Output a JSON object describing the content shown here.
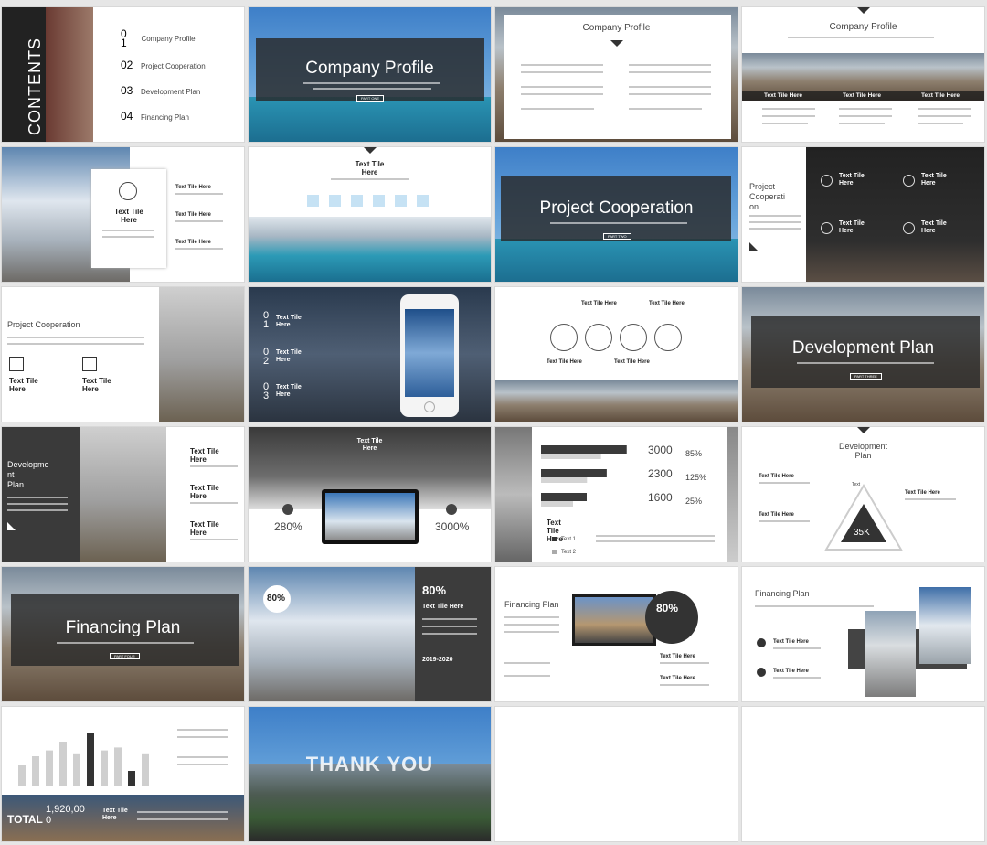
{
  "slides": {
    "s1": {
      "heading": "CONTENTS",
      "items": [
        {
          "num": "0\n1",
          "label": "Company Profile"
        },
        {
          "num": "02",
          "label": "Project Cooperation"
        },
        {
          "num": "03",
          "label": "Development Plan"
        },
        {
          "num": "04",
          "label": "Financing Plan"
        }
      ]
    },
    "s2": {
      "title": "Company Profile",
      "badge": "PART ONE"
    },
    "s3": {
      "title": "Company Profile"
    },
    "s4": {
      "title": "Company Profile",
      "labels": [
        "Text Tile Here",
        "Text Tile Here",
        "Text Tile Here"
      ]
    },
    "s5": {
      "card_title": "Text Tile\nHere",
      "items": [
        "Text Tile Here",
        "Text Tile Here",
        "Text Tile Here"
      ]
    },
    "s6": {
      "title": "Text Tile\nHere"
    },
    "s7": {
      "title": "Project Cooperation",
      "badge": "PART TWO"
    },
    "s8": {
      "title": "Project\nCooperati\non",
      "items": [
        "Text Tile\nHere",
        "Text Tile\nHere",
        "Text Tile\nHere",
        "Text Tile\nHere"
      ]
    },
    "s9": {
      "title": "Project Cooperation",
      "items": [
        "Text Tile\nHere",
        "Text Tile\nHere"
      ]
    },
    "s10": {
      "items": [
        {
          "num": "0\n1",
          "label": "Text Tile\nHere"
        },
        {
          "num": "0\n2",
          "label": "Text Tile\nHere"
        },
        {
          "num": "0\n3",
          "label": "Text Tile\nHere"
        }
      ]
    },
    "s11": {
      "labels": [
        "Text Tile Here",
        "Text Tile Here",
        "Text Tile Here",
        "Text Tile Here"
      ]
    },
    "s12": {
      "title": "Development Plan",
      "badge": "PART THREE"
    },
    "s13": {
      "title": "Developme\nnt\nPlan",
      "items": [
        "Text Tile\nHere",
        "Text Tile\nHere",
        "Text Tile\nHere"
      ]
    },
    "s14": {
      "title": "Text Tile\nHere",
      "stat_left": "280%",
      "stat_right": "3000%"
    },
    "s15": {
      "chart_data": {
        "type": "bar",
        "values": [
          3000,
          2300,
          1600
        ],
        "percents": [
          "85%",
          "125%",
          "25%"
        ],
        "series": [
          {
            "name": "Text 1"
          },
          {
            "name": "Text 2"
          }
        ]
      },
      "title": "Text\nTile\nHere"
    },
    "s16": {
      "title": "Development\nPlan",
      "items": [
        "Text Tile Here",
        "Text Tile Here",
        "Text Tile Here"
      ],
      "center": "35K",
      "vertex": "Text"
    },
    "s17": {
      "title": "Financing Plan",
      "badge": "PART FOUR"
    },
    "s18": {
      "percent": "80%",
      "title": "Text Tile Here",
      "year": "2019-2020"
    },
    "s19": {
      "title": "Financing Plan",
      "percent": "80%",
      "items": [
        "Text Tile Here",
        "Text Tile Here"
      ]
    },
    "s20": {
      "title": "Financing Plan",
      "items": [
        "Text Tile Here",
        "Text Tile Here"
      ]
    },
    "s21": {
      "chart_data": {
        "type": "bar",
        "values": [
          14,
          20,
          24,
          30,
          22,
          36,
          24,
          26,
          10,
          22
        ]
      },
      "total_label": "TOTAL",
      "total_value": "1,920,00\n0",
      "title": "Text Tile\nHere"
    },
    "s22": {
      "title": "THANK YOU"
    }
  }
}
